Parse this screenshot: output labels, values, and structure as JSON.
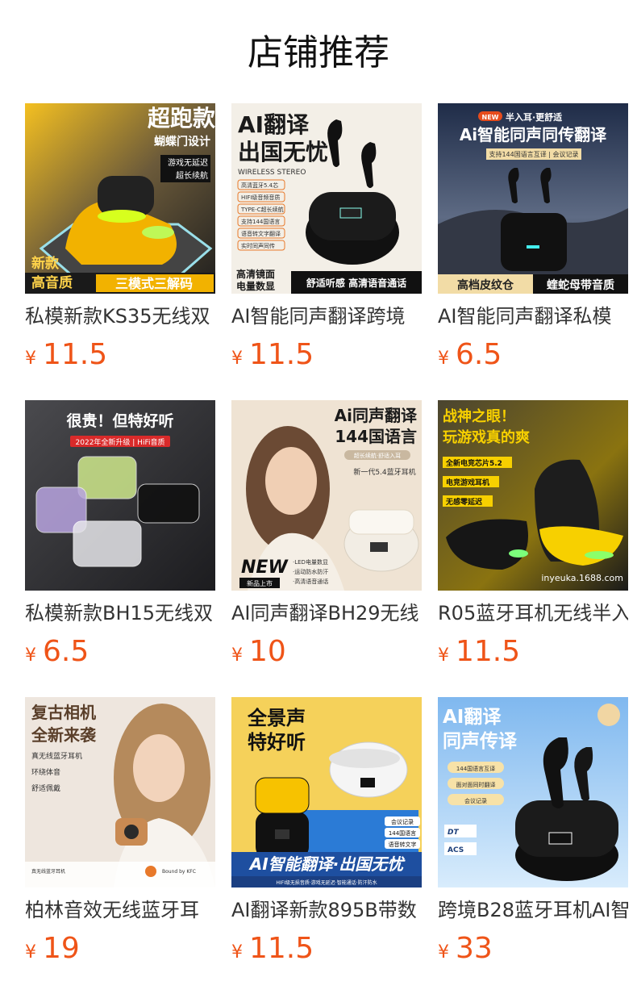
{
  "page": {
    "title": "店铺推荐"
  },
  "currency": "¥",
  "products": [
    {
      "name": "私模新款KS35无线双",
      "price": "11.5",
      "overlay": [
        "超跑款",
        "蝴蝶门设计",
        "游戏无延迟",
        "超长续航",
        "新款",
        "高音质",
        "三模式三解码"
      ],
      "colors": {
        "bg1": "#f5c32a",
        "bg2": "#2a2a2a",
        "accent": "#f2b200"
      }
    },
    {
      "name": "AI智能同声翻译跨境",
      "price": "11.5",
      "overlay": [
        "AI翻译",
        "出国无忧",
        "WIRELESS STEREO",
        "高清蓝牙5.4芯",
        "HIFI级音频音质",
        "TYPE-C超长续航",
        "支持144国语言",
        "语音转文字翻译",
        "实时同声同传",
        "高清镜面",
        "电量数显",
        "舒适听感 高清语音通话"
      ],
      "colors": {
        "bg1": "#f3efe7",
        "bg2": "#111111",
        "accent": "#e8792a"
      }
    },
    {
      "name": "AI智能同声翻译私模",
      "price": "6.5",
      "overlay": [
        "NEW",
        "半入耳·更舒适",
        "Ai智能同声同传翻译",
        "支持144国语言互译 | 会议记录",
        "高档皮纹仓",
        "蝰蛇母带音质"
      ],
      "colors": {
        "bg1": "#21304e",
        "bg2": "#5a6478",
        "accent": "#e74c1c"
      }
    },
    {
      "name": "私模新款BH15无线双",
      "price": "6.5",
      "overlay": [
        "很贵！但特好听",
        "2022年全新升级 | HiFi音质"
      ],
      "colors": {
        "bg1": "#3a3a3d",
        "bg2": "#1f1f22",
        "accent": "#d92a2a"
      }
    },
    {
      "name": "AI同声翻译BH29无线",
      "price": "10",
      "overlay": [
        "Ai同声翻译",
        "144国语言",
        "超长续航·舒适入耳",
        "新一代5.4蓝牙耳机",
        "NEW",
        "新品上市",
        "·LED电量数显",
        "·运动防水防汗",
        "·高清语音通话"
      ],
      "colors": {
        "bg1": "#f1e6d8",
        "bg2": "#d9c4a9",
        "accent": "#222222"
      }
    },
    {
      "name": "R05蓝牙耳机无线半入",
      "price": "11.5",
      "overlay": [
        "战神之眼！",
        "玩游戏真的爽",
        "全新电竞芯片5.2",
        "电竞游戏耳机",
        "无感零延迟",
        "inyeuka.1688.com"
      ],
      "colors": {
        "bg1": "#3a3a2a",
        "bg2": "#c9a200",
        "accent": "#f7d000"
      }
    },
    {
      "name": "柏林音效无线蓝牙耳",
      "price": "19",
      "overlay": [
        "复古相机",
        "全新来袭",
        "真无线蓝牙耳机",
        "环绕体音",
        "舒适佩戴",
        "真无线蓝牙耳机",
        "Bound by KFC"
      ],
      "colors": {
        "bg1": "#efe6de",
        "bg2": "#c9b8a8",
        "accent": "#8a5a2a"
      }
    },
    {
      "name": "AI翻译新款895B带数",
      "price": "11.5",
      "overlay": [
        "全景声",
        "特好听",
        "会议记录",
        "144国语言",
        "语音转文字",
        "AI智能翻译·出国无忧",
        "HIFI级无损音质·游戏无延迟·智能通话·防汗防水"
      ],
      "colors": {
        "bg1": "#f2c23a",
        "bg2": "#2b7bd6",
        "accent": "#1e4fa0"
      }
    },
    {
      "name": "跨境B28蓝牙耳机AI智",
      "price": "33",
      "overlay": [
        "AI翻译",
        "同声传译",
        "144国语言互译",
        "面对面同时翻译",
        "会议记录",
        "DT",
        "ACS"
      ],
      "colors": {
        "bg1": "#8fc2f0",
        "bg2": "#cfe6fa",
        "accent": "#1c3f7a"
      }
    }
  ]
}
